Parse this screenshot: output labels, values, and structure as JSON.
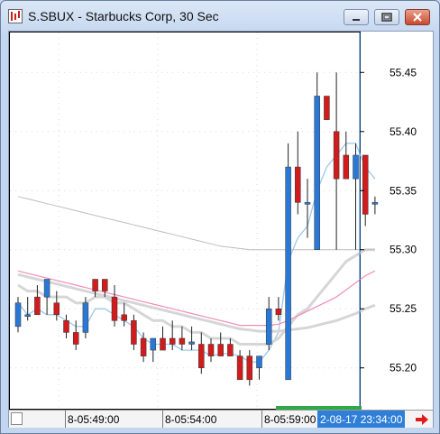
{
  "window": {
    "title": "S.SBUX - Starbucks Corp, 30 Sec",
    "minimize_label": "minimize",
    "maximize_label": "maximize",
    "close_label": "close"
  },
  "colors": {
    "up": "#2a78d6",
    "down": "#d01c1c",
    "wick": "#222222",
    "cursor": "#2a78d6",
    "ma_light_blue": "#9cc8ec",
    "ma_pink": "#f08cb4",
    "ma_gray": "#d6d6d6",
    "ma_darkgray": "#bdbdbd",
    "accent_red": "#e01b1b"
  },
  "axis": {
    "time_labels": [
      "8-05:49:00",
      "8-05:54:00",
      "8-05:59:00"
    ],
    "current_time": "2-08-17 23:34:00",
    "forward_arrow_icon": "red-right-arrow-icon"
  },
  "chart_data": {
    "type": "candlestick",
    "ylim": [
      55.17,
      55.48
    ],
    "price_ticks": [
      "55.45",
      "55.40",
      "55.35",
      "55.30",
      "55.25",
      "55.20"
    ],
    "price_tick_values": [
      55.45,
      55.4,
      55.35,
      55.3,
      55.25,
      55.2
    ],
    "candles": [
      {
        "o": 55.235,
        "h": 55.26,
        "l": 55.23,
        "c": 55.255
      },
      {
        "o": 55.245,
        "h": 55.26,
        "l": 55.24,
        "c": 55.245
      },
      {
        "o": 55.26,
        "h": 55.27,
        "l": 55.245,
        "c": 55.245
      },
      {
        "o": 55.26,
        "h": 55.265,
        "l": 55.245,
        "c": 55.275
      },
      {
        "o": 55.255,
        "h": 55.265,
        "l": 55.24,
        "c": 55.245
      },
      {
        "o": 55.24,
        "h": 55.245,
        "l": 55.225,
        "c": 55.23
      },
      {
        "o": 55.23,
        "h": 55.24,
        "l": 55.215,
        "c": 55.22
      },
      {
        "o": 55.23,
        "h": 55.26,
        "l": 55.225,
        "c": 55.255
      },
      {
        "o": 55.275,
        "h": 55.275,
        "l": 55.26,
        "c": 55.265
      },
      {
        "o": 55.275,
        "h": 55.275,
        "l": 55.26,
        "c": 55.265
      },
      {
        "o": 55.26,
        "h": 55.27,
        "l": 55.235,
        "c": 55.24
      },
      {
        "o": 55.245,
        "h": 55.255,
        "l": 55.235,
        "c": 55.24
      },
      {
        "o": 55.24,
        "h": 55.245,
        "l": 55.215,
        "c": 55.22
      },
      {
        "o": 55.225,
        "h": 55.23,
        "l": 55.205,
        "c": 55.21
      },
      {
        "o": 55.215,
        "h": 55.225,
        "l": 55.205,
        "c": 55.225
      },
      {
        "o": 55.225,
        "h": 55.235,
        "l": 55.215,
        "c": 55.215
      },
      {
        "o": 55.225,
        "h": 55.24,
        "l": 55.215,
        "c": 55.22
      },
      {
        "o": 55.225,
        "h": 55.235,
        "l": 55.215,
        "c": 55.22
      },
      {
        "o": 55.22,
        "h": 55.235,
        "l": 55.215,
        "c": 55.222
      },
      {
        "o": 55.22,
        "h": 55.23,
        "l": 55.195,
        "c": 55.2
      },
      {
        "o": 55.22,
        "h": 55.225,
        "l": 55.205,
        "c": 55.21
      },
      {
        "o": 55.22,
        "h": 55.23,
        "l": 55.21,
        "c": 55.21
      },
      {
        "o": 55.22,
        "h": 55.225,
        "l": 55.21,
        "c": 55.21
      },
      {
        "o": 55.21,
        "h": 55.215,
        "l": 55.19,
        "c": 55.19
      },
      {
        "o": 55.21,
        "h": 55.215,
        "l": 55.185,
        "c": 55.19
      },
      {
        "o": 55.2,
        "h": 55.205,
        "l": 55.19,
        "c": 55.21
      },
      {
        "o": 55.22,
        "h": 55.26,
        "l": 55.215,
        "c": 55.25
      },
      {
        "o": 55.25,
        "h": 55.26,
        "l": 55.24,
        "c": 55.245
      },
      {
        "o": 55.19,
        "h": 55.39,
        "l": 55.19,
        "c": 55.37
      },
      {
        "o": 55.37,
        "h": 55.4,
        "l": 55.33,
        "c": 55.34
      },
      {
        "o": 55.34,
        "h": 55.36,
        "l": 55.31,
        "c": 55.34
      },
      {
        "o": 55.3,
        "h": 55.45,
        "l": 55.3,
        "c": 55.43
      },
      {
        "o": 55.43,
        "h": 55.43,
        "l": 55.41,
        "c": 55.41
      },
      {
        "o": 55.4,
        "h": 55.45,
        "l": 55.3,
        "c": 55.36
      },
      {
        "o": 55.38,
        "h": 55.4,
        "l": 55.36,
        "c": 55.36
      },
      {
        "o": 55.36,
        "h": 55.39,
        "l": 55.3,
        "c": 55.38
      },
      {
        "o": 55.38,
        "h": 55.38,
        "l": 55.32,
        "c": 55.33
      },
      {
        "o": 55.34,
        "h": 55.345,
        "l": 55.33,
        "c": 55.34
      }
    ],
    "series": [
      {
        "values": [
          55.255,
          55.245,
          55.25,
          55.245,
          55.245,
          55.24,
          55.235,
          55.235,
          55.25,
          55.25,
          55.245,
          55.24,
          55.235,
          55.225,
          55.22,
          55.22,
          55.22,
          55.215,
          55.215,
          55.215,
          55.21,
          55.212,
          55.212,
          55.21,
          55.205,
          55.205,
          55.215,
          55.23,
          55.29,
          55.31,
          55.32,
          55.35,
          55.37,
          55.38,
          55.39,
          55.39,
          55.37,
          55.36
        ]
      },
      {
        "values": [
          55.27,
          55.265,
          55.265,
          55.26,
          55.26,
          55.26,
          55.255,
          55.255,
          55.26,
          55.26,
          55.255,
          55.255,
          55.25,
          55.245,
          55.24,
          55.24,
          55.235,
          55.235,
          55.23,
          55.23,
          55.225,
          55.225,
          55.225,
          55.22,
          55.22,
          55.22,
          55.22,
          55.225,
          55.235,
          55.245,
          55.25,
          55.26,
          55.27,
          55.28,
          55.29,
          55.295,
          55.3,
          55.3
        ]
      },
      {
        "values": [
          55.282,
          55.28,
          55.278,
          55.276,
          55.274,
          55.272,
          55.27,
          55.268,
          55.266,
          55.264,
          55.262,
          55.26,
          55.258,
          55.256,
          55.254,
          55.252,
          55.25,
          55.248,
          55.246,
          55.244,
          55.242,
          55.24,
          55.238,
          55.236,
          55.236,
          55.236,
          55.236,
          55.237,
          55.24,
          55.244,
          55.248,
          55.252,
          55.256,
          55.26,
          55.266,
          55.272,
          55.278,
          55.282
        ]
      },
      {
        "values": [
          55.279,
          55.277,
          55.275,
          55.273,
          55.271,
          55.269,
          55.267,
          55.265,
          55.263,
          55.261,
          55.259,
          55.257,
          55.255,
          55.253,
          55.251,
          55.249,
          55.247,
          55.245,
          55.243,
          55.241,
          55.239,
          55.237,
          55.235,
          55.233,
          55.232,
          55.231,
          55.231,
          55.231,
          55.232,
          55.233,
          55.234,
          55.236,
          55.238,
          55.24,
          55.243,
          55.246,
          55.25,
          55.253
        ]
      },
      {
        "values": [
          55.345,
          55.343,
          55.341,
          55.339,
          55.337,
          55.335,
          55.333,
          55.331,
          55.329,
          55.327,
          55.325,
          55.323,
          55.321,
          55.319,
          55.317,
          55.315,
          55.313,
          55.311,
          55.309,
          55.307,
          55.305,
          55.303,
          55.302,
          55.301,
          55.3,
          55.3,
          55.3,
          55.3,
          55.3,
          55.3,
          55.3,
          55.3,
          55.3,
          55.3,
          55.3,
          55.3,
          55.3,
          55.3
        ]
      }
    ]
  }
}
